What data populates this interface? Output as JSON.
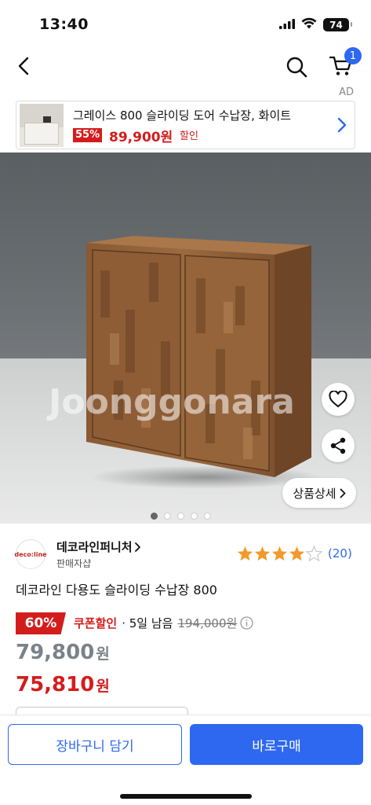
{
  "status_bar": {
    "time": "13:40",
    "battery": "74"
  },
  "header": {
    "cart_count": "1",
    "ad_label": "AD"
  },
  "ad_banner": {
    "title": "그레이스 800 슬라이딩 도어 수납장, 화이트",
    "discount": "55%",
    "price": "89,900원",
    "sale_label": "할인"
  },
  "product_image": {
    "watermark": "Joonggonara",
    "detail_button": "상품상세",
    "page_count": 5,
    "active_page": 1
  },
  "seller": {
    "logo_text": "deco:line",
    "name": "데코라인퍼니처",
    "type": "판매자샵"
  },
  "rating": {
    "stars": 4,
    "review_count": "(20)"
  },
  "product": {
    "title": "데코라인 다용도 슬라이딩 수납장 800"
  },
  "price": {
    "discount": "60%",
    "coupon_label": "쿠폰할인",
    "remain": "· 5일 남음",
    "original": "194,000원",
    "price_before_coupon": "79,800",
    "final_price": "75,810",
    "won": "원"
  },
  "bottom_bar": {
    "cart_button": "장바구니 담기",
    "buy_button": "바로구매"
  },
  "colors": {
    "accent": "#2e67f0",
    "sale": "#d31d1d",
    "star": "#f39a2b"
  }
}
